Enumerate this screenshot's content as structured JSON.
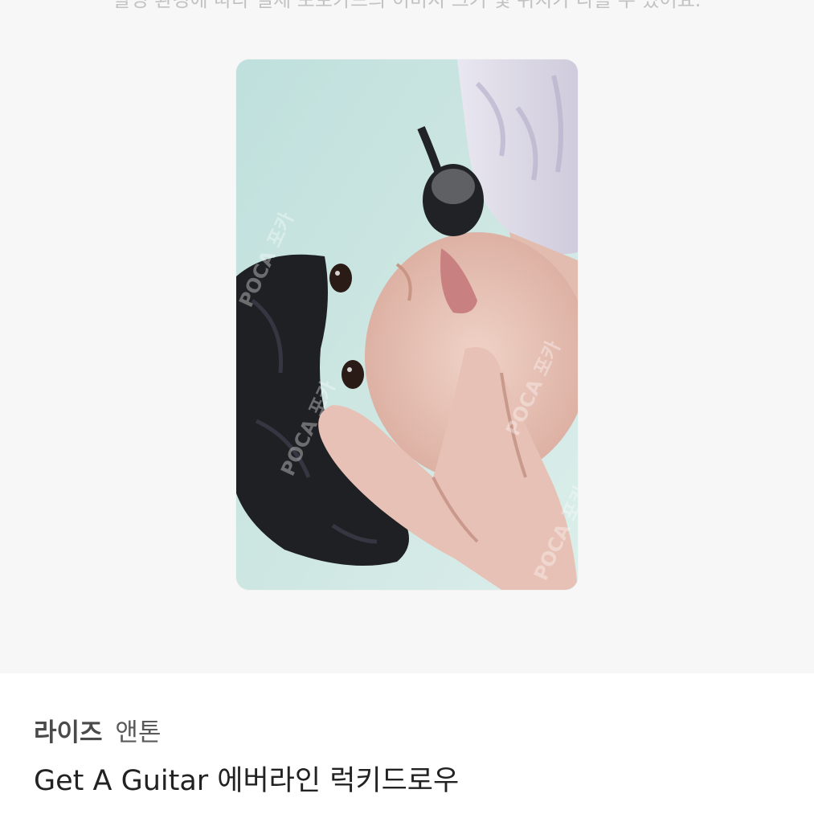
{
  "notice": {
    "text": "촬영 환경에 따라 실제 포토카드의 이미지 크기 및 위치가 다를 수 있어요."
  },
  "photocard": {
    "watermark": "POCA 포카",
    "colors": {
      "background": "#c8e3df",
      "hair": "#1f2024",
      "skin": "#e8c7bb",
      "microphone": "#202226"
    }
  },
  "product": {
    "group": "라이즈",
    "member": "앤톤",
    "title": "Get A Guitar 에버라인 럭키드로우"
  },
  "colors": {
    "page_background": "#ffffff",
    "image_area_background": "#f7f7f7",
    "title_text": "#222222",
    "notice_text": "#c2c2c2"
  }
}
